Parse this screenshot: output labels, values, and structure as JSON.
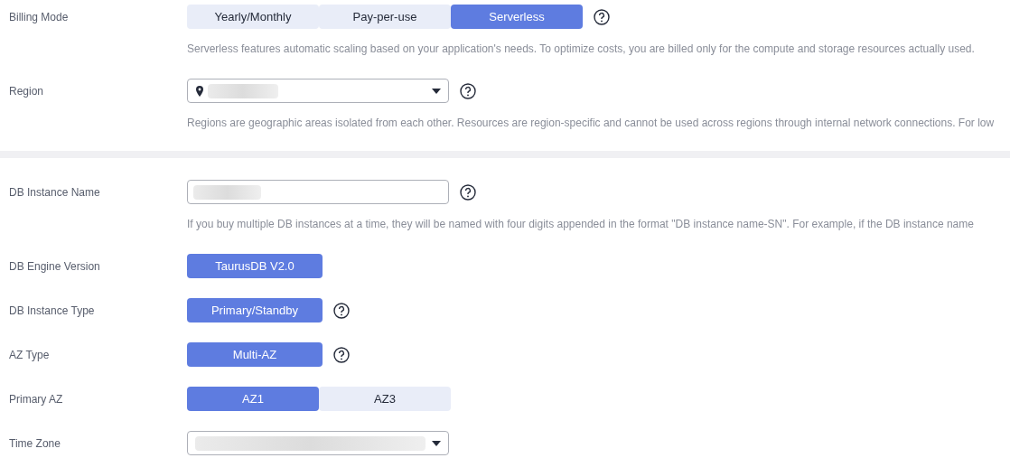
{
  "sections": [
    {
      "rows": [
        {
          "kind": "segmented",
          "label": "Billing Mode",
          "options": [
            {
              "label": "Yearly/Monthly",
              "selected": false
            },
            {
              "label": "Pay-per-use",
              "selected": false
            },
            {
              "label": "Serverless",
              "selected": true
            }
          ],
          "help": true,
          "hint": "Serverless features automatic scaling based on your application's needs. To optimize costs, you are billed only for the compute and storage resources actually used."
        },
        {
          "kind": "select",
          "label": "Region",
          "location": true,
          "help": true,
          "hint": "Regions are geographic areas isolated from each other. Resources are region-specific and cannot be used across regions through internal network connections. For low"
        }
      ]
    },
    {
      "rows": [
        {
          "kind": "input",
          "label": "DB Instance Name",
          "help": true,
          "hint": "If you buy multiple DB instances at a time, they will be named with four digits appended in the format \"DB instance name-SN\". For example, if the DB instance name"
        },
        {
          "kind": "segmented",
          "label": "DB Engine Version",
          "options": [
            {
              "label": "TaurusDB V2.0",
              "selected": true
            }
          ],
          "help": false
        },
        {
          "kind": "segmented",
          "label": "DB Instance Type",
          "options": [
            {
              "label": "Primary/Standby",
              "selected": true
            }
          ],
          "help": true
        },
        {
          "kind": "segmented",
          "label": "AZ Type",
          "options": [
            {
              "label": "Multi-AZ",
              "selected": true
            }
          ],
          "help": true
        },
        {
          "kind": "segmented",
          "label": "Primary AZ",
          "options": [
            {
              "label": "AZ1",
              "selected": true
            },
            {
              "label": "AZ3",
              "selected": false
            }
          ],
          "help": false
        },
        {
          "kind": "select",
          "label": "Time Zone",
          "location": false,
          "help": false
        }
      ]
    }
  ]
}
